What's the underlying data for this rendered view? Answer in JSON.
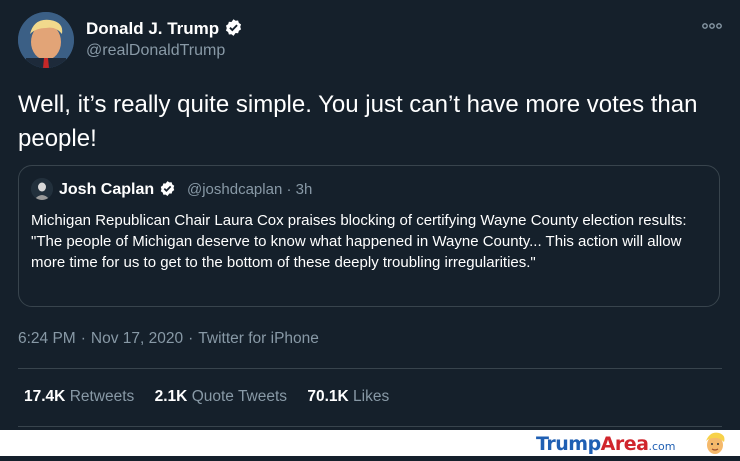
{
  "author": {
    "name": "Donald J. Trump",
    "handle": "@realDonaldTrump"
  },
  "tweet": {
    "text": "Well, it’s really quite simple. You just can’t have more votes than people!"
  },
  "quoted_tweet": {
    "name": "Josh Caplan",
    "handle_time": "@joshdcaplan · 3h",
    "text": "Michigan Republican Chair Laura Cox praises blocking of certifying Wayne County election results: \"The people of Michigan deserve to know what happened in Wayne County... This action will allow more time for us to get to the bottom of these deeply troubling irregularities.\""
  },
  "meta": {
    "time": "6:24 PM",
    "date": "Nov 17, 2020",
    "source": "Twitter for iPhone",
    "separator": "·"
  },
  "stats": {
    "retweets_count": "17.4K",
    "retweets_label": "Retweets",
    "quote_count": "2.1K",
    "quote_label": "Quote Tweets",
    "likes_count": "70.1K",
    "likes_label": "Likes"
  },
  "watermark": {
    "brand_trump": "Trump",
    "brand_area": "Area",
    "brand_com": ".com"
  },
  "colors": {
    "background": "#15202b",
    "secondary_text": "#8899a6",
    "verified": "#ffffff",
    "border": "#38444d"
  },
  "icons": [
    "verified-badge-icon",
    "more-options-icon",
    "avatar",
    "mascot-icon"
  ]
}
